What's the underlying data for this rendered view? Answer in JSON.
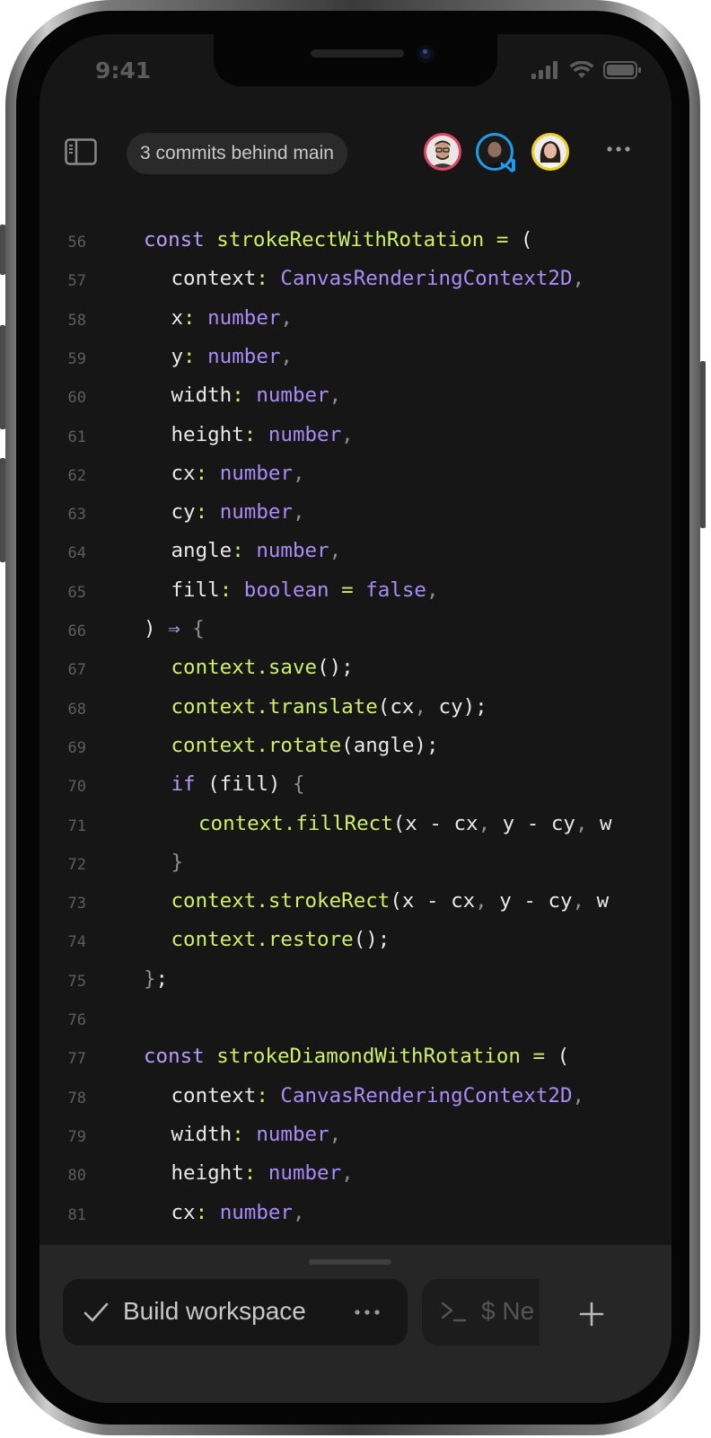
{
  "status_bar": {
    "time": "9:41"
  },
  "toolbar": {
    "branch_status": "3 commits behind main",
    "avatars": [
      {
        "name": "collaborator-1",
        "ring_color": "#e2456a"
      },
      {
        "name": "collaborator-2",
        "ring_color": "#1e9be8",
        "badge": "vscode-icon"
      },
      {
        "name": "collaborator-3",
        "ring_color": "#f2d21c"
      }
    ]
  },
  "colors": {
    "keyword": "#b69cf6",
    "function": "#cfee6a",
    "type": "#a98cf7",
    "text": "#e8e8e8",
    "punctuation": "#8f8f8f",
    "line_number": "#5e5e5e",
    "background": "#161616"
  },
  "code": {
    "lines": [
      {
        "n": "56",
        "indent": 0,
        "tokens": [
          [
            "kw",
            "const "
          ],
          [
            "fn",
            "strokeRectWithRotation"
          ],
          [
            "pl",
            " "
          ],
          [
            "fn",
            "="
          ],
          [
            "pl",
            " ("
          ]
        ]
      },
      {
        "n": "57",
        "indent": 1,
        "tokens": [
          [
            "pl",
            "context"
          ],
          [
            "fn",
            ":"
          ],
          [
            "pl",
            " "
          ],
          [
            "ty",
            "CanvasRenderingContext2D"
          ],
          [
            "pu",
            ","
          ]
        ]
      },
      {
        "n": "58",
        "indent": 1,
        "tokens": [
          [
            "pl",
            "x"
          ],
          [
            "fn",
            ":"
          ],
          [
            "pl",
            " "
          ],
          [
            "ty",
            "number"
          ],
          [
            "pu",
            ","
          ]
        ]
      },
      {
        "n": "59",
        "indent": 1,
        "tokens": [
          [
            "pl",
            "y"
          ],
          [
            "fn",
            ":"
          ],
          [
            "pl",
            " "
          ],
          [
            "ty",
            "number"
          ],
          [
            "pu",
            ","
          ]
        ]
      },
      {
        "n": "60",
        "indent": 1,
        "tokens": [
          [
            "pl",
            "width"
          ],
          [
            "fn",
            ":"
          ],
          [
            "pl",
            " "
          ],
          [
            "ty",
            "number"
          ],
          [
            "pu",
            ","
          ]
        ]
      },
      {
        "n": "61",
        "indent": 1,
        "tokens": [
          [
            "pl",
            "height"
          ],
          [
            "fn",
            ":"
          ],
          [
            "pl",
            " "
          ],
          [
            "ty",
            "number"
          ],
          [
            "pu",
            ","
          ]
        ]
      },
      {
        "n": "62",
        "indent": 1,
        "tokens": [
          [
            "pl",
            "cx"
          ],
          [
            "fn",
            ":"
          ],
          [
            "pl",
            " "
          ],
          [
            "ty",
            "number"
          ],
          [
            "pu",
            ","
          ]
        ]
      },
      {
        "n": "63",
        "indent": 1,
        "tokens": [
          [
            "pl",
            "cy"
          ],
          [
            "fn",
            ":"
          ],
          [
            "pl",
            " "
          ],
          [
            "ty",
            "number"
          ],
          [
            "pu",
            ","
          ]
        ]
      },
      {
        "n": "64",
        "indent": 1,
        "tokens": [
          [
            "pl",
            "angle"
          ],
          [
            "fn",
            ":"
          ],
          [
            "pl",
            " "
          ],
          [
            "ty",
            "number"
          ],
          [
            "pu",
            ","
          ]
        ]
      },
      {
        "n": "65",
        "indent": 1,
        "tokens": [
          [
            "pl",
            "fill"
          ],
          [
            "fn",
            ":"
          ],
          [
            "pl",
            " "
          ],
          [
            "ty",
            "boolean"
          ],
          [
            "pl",
            " "
          ],
          [
            "fn",
            "="
          ],
          [
            "pl",
            " "
          ],
          [
            "ty",
            "false"
          ],
          [
            "pu",
            ","
          ]
        ]
      },
      {
        "n": "66",
        "indent": 0,
        "tokens": [
          [
            "pl",
            ") "
          ],
          [
            "kw",
            "⇒"
          ],
          [
            "pl",
            " "
          ],
          [
            "pu",
            "{"
          ]
        ]
      },
      {
        "n": "67",
        "indent": 1,
        "tokens": [
          [
            "fn",
            "context.save"
          ],
          [
            "pl",
            "();"
          ]
        ]
      },
      {
        "n": "68",
        "indent": 1,
        "tokens": [
          [
            "fn",
            "context.translate"
          ],
          [
            "pl",
            "(cx"
          ],
          [
            "pu",
            ","
          ],
          [
            "pl",
            " cy);"
          ]
        ]
      },
      {
        "n": "69",
        "indent": 1,
        "tokens": [
          [
            "fn",
            "context.rotate"
          ],
          [
            "pl",
            "(angle);"
          ]
        ]
      },
      {
        "n": "70",
        "indent": 1,
        "tokens": [
          [
            "kw",
            "if"
          ],
          [
            "pl",
            " (fill) "
          ],
          [
            "pu",
            "{"
          ]
        ]
      },
      {
        "n": "71",
        "indent": 2,
        "tokens": [
          [
            "fn",
            "context.fillRect"
          ],
          [
            "pl",
            "(x - cx"
          ],
          [
            "pu",
            ","
          ],
          [
            "pl",
            " y - cy"
          ],
          [
            "pu",
            ","
          ],
          [
            "pl",
            " w"
          ]
        ]
      },
      {
        "n": "72",
        "indent": 1,
        "tokens": [
          [
            "pu",
            "}"
          ]
        ]
      },
      {
        "n": "73",
        "indent": 1,
        "tokens": [
          [
            "fn",
            "context.strokeRect"
          ],
          [
            "pl",
            "(x - cx"
          ],
          [
            "pu",
            ","
          ],
          [
            "pl",
            " y - cy"
          ],
          [
            "pu",
            ","
          ],
          [
            "pl",
            " w"
          ]
        ]
      },
      {
        "n": "74",
        "indent": 1,
        "tokens": [
          [
            "fn",
            "context.restore"
          ],
          [
            "pl",
            "();"
          ]
        ]
      },
      {
        "n": "75",
        "indent": 0,
        "tokens": [
          [
            "pu",
            "}"
          ],
          [
            "pl",
            ";"
          ]
        ]
      },
      {
        "n": "76",
        "indent": 0,
        "tokens": []
      },
      {
        "n": "77",
        "indent": 0,
        "tokens": [
          [
            "kw",
            "const "
          ],
          [
            "fn",
            "strokeDiamondWithRotation"
          ],
          [
            "pl",
            " "
          ],
          [
            "fn",
            "="
          ],
          [
            "pl",
            " ("
          ]
        ]
      },
      {
        "n": "78",
        "indent": 1,
        "tokens": [
          [
            "pl",
            "context"
          ],
          [
            "fn",
            ":"
          ],
          [
            "pl",
            " "
          ],
          [
            "ty",
            "CanvasRenderingContext2D"
          ],
          [
            "pu",
            ","
          ]
        ]
      },
      {
        "n": "79",
        "indent": 1,
        "tokens": [
          [
            "pl",
            "width"
          ],
          [
            "fn",
            ":"
          ],
          [
            "pl",
            " "
          ],
          [
            "ty",
            "number"
          ],
          [
            "pu",
            ","
          ]
        ]
      },
      {
        "n": "80",
        "indent": 1,
        "tokens": [
          [
            "pl",
            "height"
          ],
          [
            "fn",
            ":"
          ],
          [
            "pl",
            " "
          ],
          [
            "ty",
            "number"
          ],
          [
            "pu",
            ","
          ]
        ]
      },
      {
        "n": "81",
        "indent": 1,
        "tokens": [
          [
            "pl",
            "cx"
          ],
          [
            "fn",
            ":"
          ],
          [
            "pl",
            " "
          ],
          [
            "ty",
            "number"
          ],
          [
            "pu",
            ","
          ]
        ]
      }
    ]
  },
  "bottom_panel": {
    "task_label": "Build workspace",
    "terminal_label": "$ Ne"
  }
}
